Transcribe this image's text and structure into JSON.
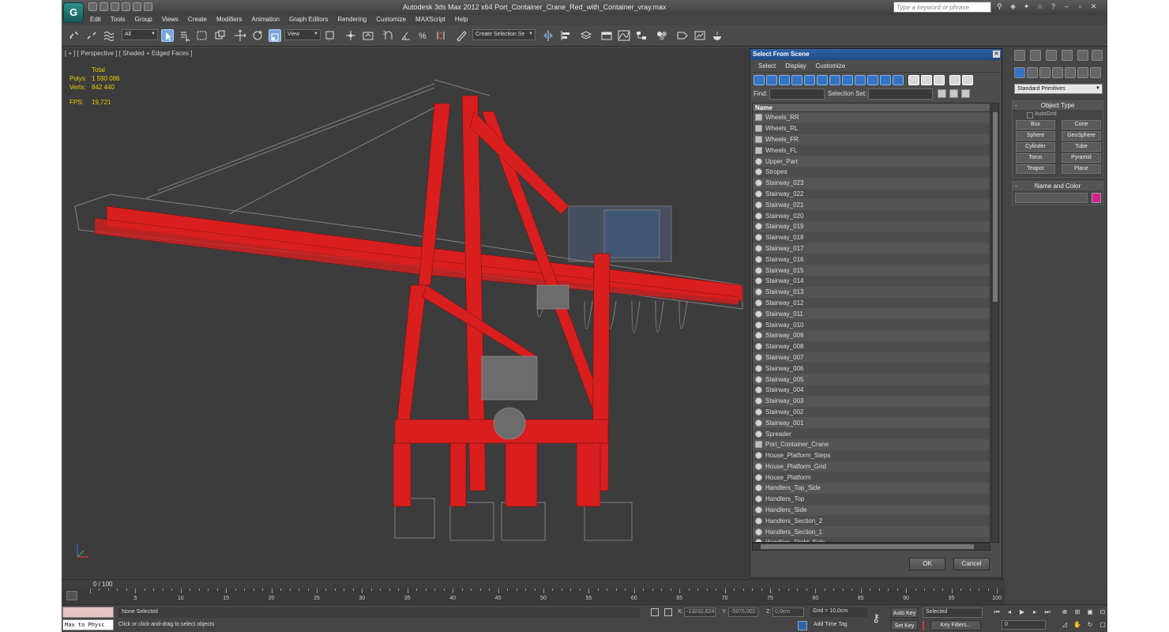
{
  "window": {
    "title": "Autodesk 3ds Max  2012 x64     Port_Container_Crane_Red_with_Container_vray.max",
    "search_placeholder": "Type a keyword or phrase",
    "logo_text": "G"
  },
  "menu": [
    "Edit",
    "Tools",
    "Group",
    "Views",
    "Create",
    "Modifiers",
    "Animation",
    "Graph Editors",
    "Rendering",
    "Customize",
    "MAXScript",
    "Help"
  ],
  "toolbar": {
    "filter_value": "All",
    "ref_coord_value": "View",
    "named_selection_placeholder": "Create Selection Se"
  },
  "viewport": {
    "label": "[ + ] [ Perspective ] [ Shaded + Edged Faces ]",
    "stats_header": "Total",
    "polys_label": "Polys:",
    "polys_value": "1 590 086",
    "verts_label": "Verts:",
    "verts_value": "842 440",
    "fps_label": "FPS:",
    "fps_value": "19,721",
    "crane_color": "#d81e1e",
    "wire_color": "#8a8a8a"
  },
  "dialog": {
    "title": "Select From Scene",
    "menu": [
      "Select",
      "Display",
      "Customize"
    ],
    "find_label": "Find:",
    "selection_set_label": "Selection Set:",
    "column_header": "Name",
    "items": [
      {
        "name": "Wheels_RR",
        "icon": "group-icon"
      },
      {
        "name": "Wheels_RL",
        "icon": "group-icon"
      },
      {
        "name": "Wheels_FR",
        "icon": "group-icon"
      },
      {
        "name": "Wheels_FL",
        "icon": "group-icon"
      },
      {
        "name": "Upper_Part",
        "icon": "object-icon"
      },
      {
        "name": "Stropes",
        "icon": "object-icon"
      },
      {
        "name": "Stairway_023",
        "icon": "object-icon"
      },
      {
        "name": "Stairway_022",
        "icon": "object-icon"
      },
      {
        "name": "Stairway_021",
        "icon": "object-icon"
      },
      {
        "name": "Stairway_020",
        "icon": "object-icon"
      },
      {
        "name": "Stairway_019",
        "icon": "object-icon"
      },
      {
        "name": "Stairway_018",
        "icon": "object-icon"
      },
      {
        "name": "Stairway_017",
        "icon": "object-icon"
      },
      {
        "name": "Stairway_016",
        "icon": "object-icon"
      },
      {
        "name": "Stairway_015",
        "icon": "object-icon"
      },
      {
        "name": "Stairway_014",
        "icon": "object-icon"
      },
      {
        "name": "Stairway_013",
        "icon": "object-icon"
      },
      {
        "name": "Stairway_012",
        "icon": "object-icon"
      },
      {
        "name": "Stairway_011",
        "icon": "object-icon"
      },
      {
        "name": "Stairway_010",
        "icon": "object-icon"
      },
      {
        "name": "Stairway_009",
        "icon": "object-icon"
      },
      {
        "name": "Stairway_008",
        "icon": "object-icon"
      },
      {
        "name": "Stairway_007",
        "icon": "object-icon"
      },
      {
        "name": "Stairway_006",
        "icon": "object-icon"
      },
      {
        "name": "Stairway_005",
        "icon": "object-icon"
      },
      {
        "name": "Stairway_004",
        "icon": "object-icon"
      },
      {
        "name": "Stairway_003",
        "icon": "object-icon"
      },
      {
        "name": "Stairway_002",
        "icon": "object-icon"
      },
      {
        "name": "Stairway_001",
        "icon": "object-icon"
      },
      {
        "name": "Spreader",
        "icon": "object-icon"
      },
      {
        "name": "Port_Container_Crane",
        "icon": "group-icon"
      },
      {
        "name": "House_Platform_Steps",
        "icon": "object-icon"
      },
      {
        "name": "House_Platform_Grid",
        "icon": "object-icon"
      },
      {
        "name": "House_Platform",
        "icon": "object-icon"
      },
      {
        "name": "Handlers_Top_Side",
        "icon": "object-icon"
      },
      {
        "name": "Handlers_Top",
        "icon": "object-icon"
      },
      {
        "name": "Handlers_Side",
        "icon": "object-icon"
      },
      {
        "name": "Handlers_Section_2",
        "icon": "object-icon"
      },
      {
        "name": "Handlers_Section_1",
        "icon": "object-icon"
      },
      {
        "name": "Handlers_Right_Side",
        "icon": "object-icon"
      }
    ],
    "ok_label": "OK",
    "cancel_label": "Cancel"
  },
  "command_panel": {
    "primitive_type": "Standard Primitives",
    "object_type_title": "Object Type",
    "autogrid_label": "AutoGrid",
    "buttons": [
      "Box",
      "Cone",
      "Sphere",
      "GeoSphere",
      "Cylinder",
      "Tube",
      "Torus",
      "Pyramid",
      "Teapot",
      "Plane"
    ],
    "name_color_title": "Name and Color",
    "object_color": "#d4208c"
  },
  "timeline": {
    "frame_label": "0 / 100",
    "ticks": [
      "5",
      "10",
      "15",
      "20",
      "25",
      "30",
      "35",
      "40",
      "45",
      "50",
      "55",
      "60",
      "65",
      "70",
      "75",
      "80",
      "85",
      "90",
      "95",
      "100"
    ]
  },
  "status": {
    "listener_text": "Max to Physc",
    "selection_text": "None Selected",
    "prompt_text": "Click or click-and-drag to select objects",
    "x_label": "X:",
    "x_value": "-13232,624",
    "y_label": "Y:",
    "y_value": "-5976,002",
    "z_label": "Z:",
    "z_value": "0,0cm",
    "grid_text": "Grid = 10,0cm",
    "add_time_tag": "Add Time Tag",
    "auto_key": "Auto Key",
    "set_key": "Set Key",
    "selected_value": "Selected",
    "key_filters": "Key Filters...",
    "frame_value": "0"
  }
}
